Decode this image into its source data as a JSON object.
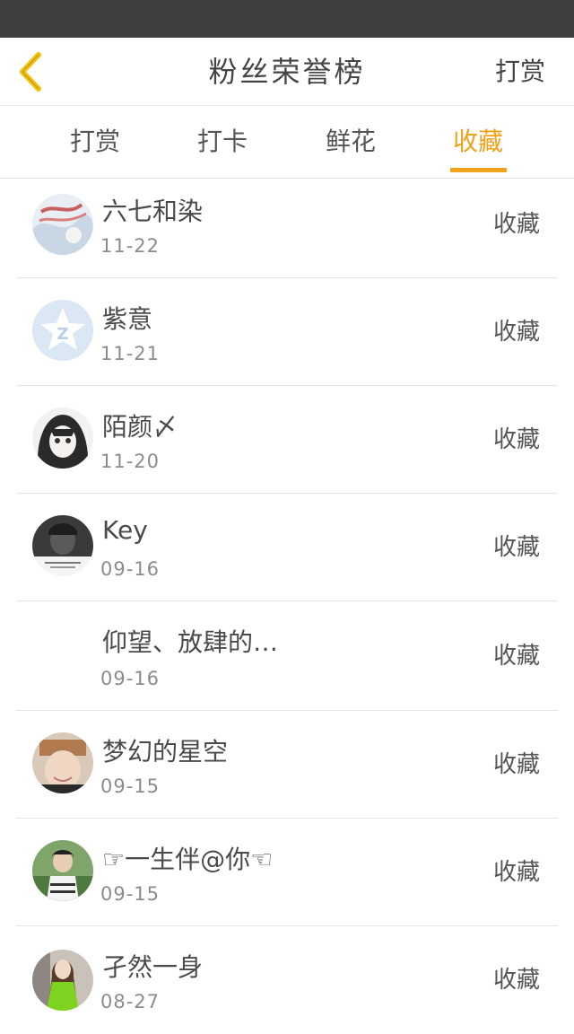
{
  "header": {
    "title": "粉丝荣誉榜",
    "action_label": "打赏"
  },
  "tabs": [
    {
      "label": "打赏",
      "active": false
    },
    {
      "label": "打卡",
      "active": false
    },
    {
      "label": "鲜花",
      "active": false
    },
    {
      "label": "收藏",
      "active": true
    }
  ],
  "colors": {
    "accent": "#f2a11a",
    "status_bar": "#3e3e3e",
    "back_arrow": "#f5c20b"
  },
  "list": [
    {
      "name": "六七和染",
      "date": "11-22",
      "type": "收藏",
      "avatar": "avatar-illustration"
    },
    {
      "name": "紫意",
      "date": "11-21",
      "type": "收藏",
      "avatar": "qzone-default-avatar"
    },
    {
      "name": "陌颜〆",
      "date": "11-20",
      "type": "收藏",
      "avatar": "avatar-anime-girl"
    },
    {
      "name": "Key",
      "date": "09-16",
      "type": "收藏",
      "avatar": "avatar-dark-photo"
    },
    {
      "name": "仰望、放肆的…",
      "date": "09-16",
      "type": "收藏",
      "avatar": ""
    },
    {
      "name": "梦幻的星空",
      "date": "09-15",
      "type": "收藏",
      "avatar": "avatar-face-photo"
    },
    {
      "name": "☞一生伴@你☜",
      "date": "09-15",
      "type": "收藏",
      "avatar": "avatar-boy-photo"
    },
    {
      "name": "孑然一身",
      "date": "08-27",
      "type": "收藏",
      "avatar": "avatar-girl-green"
    }
  ]
}
